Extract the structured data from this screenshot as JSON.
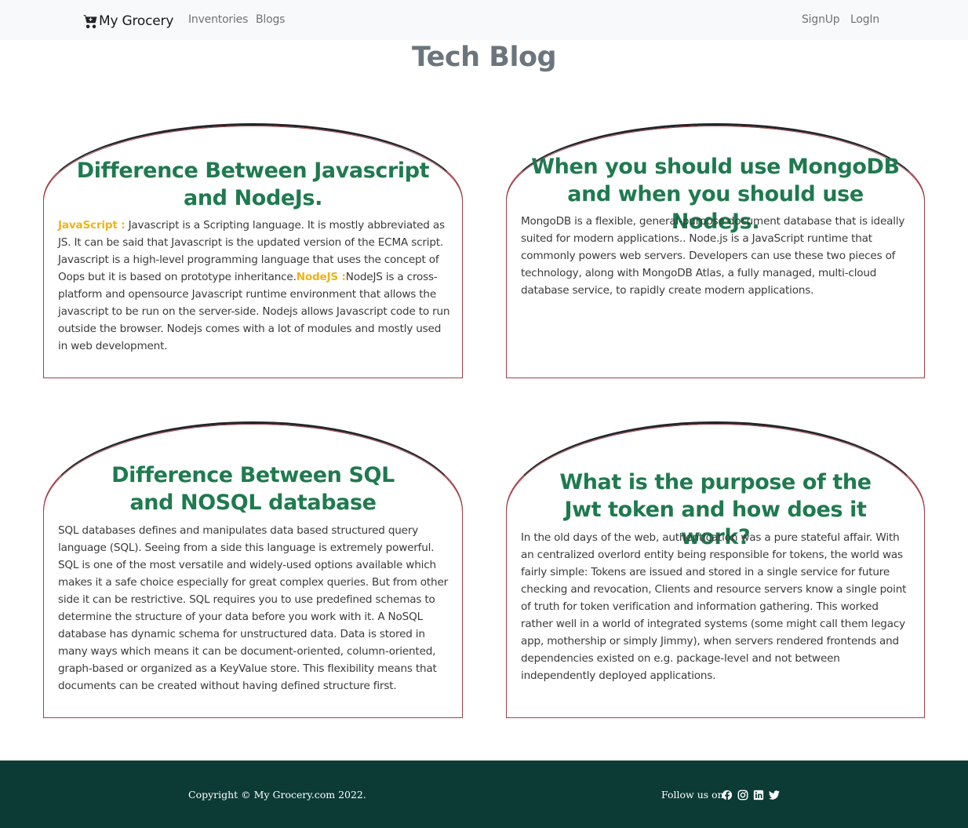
{
  "navbar": {
    "brand": "My Grocery",
    "links": [
      "Inventories",
      "Blogs"
    ],
    "auth": [
      "SignUp",
      "LogIn"
    ]
  },
  "page_title": "Tech Blog",
  "cards": [
    {
      "title": "Difference Between Javascript and NodeJs.",
      "label1": "JavaScript :",
      "text1": " Javascript is a Scripting language. It is mostly abbreviated as JS. It can be said that Javascript is the updated version of the ECMA script. Javascript is a high-level programming language that uses the concept of Oops but it is based on prototype inheritance.",
      "label2": "NodeJS :",
      "text2": "NodeJS is a cross-platform and opensource Javascript runtime environment that allows the javascript to be run on the server-side. Nodejs allows Javascript code to run outside the browser. Nodejs comes with a lot of modules and mostly used in web development."
    },
    {
      "title": "When you should use MongoDB and when you should use NodeJs.",
      "text": "MongoDB is a flexible, general-purpose document database that is ideally suited for modern applications.. Node.js is a JavaScript runtime that commonly powers web servers. Developers can use these two pieces of technology, along with MongoDB Atlas, a fully managed, multi-cloud database service, to rapidly create modern applications."
    },
    {
      "title": "Difference Between SQL and NOSQL database",
      "text": "SQL databases defines and manipulates data based structured query language (SQL). Seeing from a side this language is extremely powerful. SQL is one of the most versatile and widely-used options available which makes it a safe choice especially for great complex queries. But from other side it can be restrictive. SQL requires you to use predefined schemas to determine the structure of your data before you work with it. A NoSQL database has dynamic schema for unstructured data. Data is stored in many ways which means it can be document-oriented, column-oriented, graph-based or organized as a KeyValue store. This flexibility means that documents can be created without having defined structure first."
    },
    {
      "title": "What is the purpose of the Jwt token and how does it work?",
      "text": "In the old days of the web, authentication was a pure stateful affair. With an centralized overlord entity being responsible for tokens, the world was fairly simple: Tokens are issued and stored in a single service for future checking and revocation, Clients and resource servers know a single point of truth for token verification and information gathering. This worked rather well in a world of integrated systems (some might call them legacy app, mothership or simply Jimmy), when servers rendered frontends and dependencies existed on e.g. package-level and not between independently deployed applications."
    }
  ],
  "footer": {
    "copyright": "Copyright © My Grocery.com 2022.",
    "follow": "Follow us on:",
    "social_icons": [
      "facebook-icon",
      "instagram-icon",
      "linkedin-icon",
      "twitter-icon"
    ]
  },
  "colors": {
    "card_border": "#a0414b",
    "card_title": "#1f7a4f",
    "highlight": "#f0b41a",
    "footer_bg": "#0c3b36",
    "navbar_bg": "#f8f9fa"
  }
}
